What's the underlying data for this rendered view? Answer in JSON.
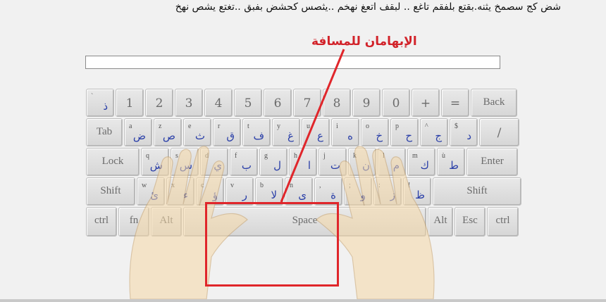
{
  "practice_text": "شض كج سصمخ يثنه.بقتع بلفقم تاغع .. لبقف اتعغ نهخم ..يثصس كحشض بفبق ..تغتع يشص نهخ",
  "callout": "الإبهامان للمسافة",
  "input": {
    "value": ""
  },
  "keyboard": {
    "row1": [
      {
        "lat": "`",
        "ar": "ذ"
      },
      {
        "main": "1"
      },
      {
        "main": "2"
      },
      {
        "main": "3"
      },
      {
        "main": "4"
      },
      {
        "main": "5"
      },
      {
        "main": "6"
      },
      {
        "main": "7"
      },
      {
        "main": "8"
      },
      {
        "main": "9"
      },
      {
        "main": "0"
      },
      {
        "main": "+"
      },
      {
        "main": "="
      },
      {
        "label": "Back"
      }
    ],
    "row2": [
      {
        "label": "Tab"
      },
      {
        "lat": "a",
        "ar": "ض"
      },
      {
        "lat": "z",
        "ar": "ص"
      },
      {
        "lat": "e",
        "ar": "ث"
      },
      {
        "lat": "r",
        "ar": "ق"
      },
      {
        "lat": "t",
        "ar": "ف"
      },
      {
        "lat": "y",
        "ar": "غ"
      },
      {
        "lat": "u",
        "ar": "ع"
      },
      {
        "lat": "i",
        "ar": "ه"
      },
      {
        "lat": "o",
        "ar": "خ"
      },
      {
        "lat": "p",
        "ar": "ح"
      },
      {
        "lat": "^",
        "ar": "ج"
      },
      {
        "lat": "$",
        "ar": "د"
      },
      {
        "main": "/"
      }
    ],
    "row3": [
      {
        "label": "Lock"
      },
      {
        "lat": "q",
        "ar": "ش"
      },
      {
        "lat": "s",
        "ar": "س"
      },
      {
        "lat": "d",
        "ar": "ي"
      },
      {
        "lat": "f",
        "ar": "ب"
      },
      {
        "lat": "g",
        "ar": "ل"
      },
      {
        "lat": "h",
        "ar": "ا"
      },
      {
        "lat": "j",
        "ar": "ت"
      },
      {
        "lat": "k",
        "ar": "ن"
      },
      {
        "lat": "l",
        "ar": "م"
      },
      {
        "lat": "m",
        "ar": "ك"
      },
      {
        "lat": "ù",
        "ar": "ط"
      },
      {
        "label": "Enter"
      }
    ],
    "row4": [
      {
        "label": "Shift"
      },
      {
        "lat": "w",
        "ar": "ئ"
      },
      {
        "lat": "x",
        "ar": "ء"
      },
      {
        "lat": "c",
        "ar": "ؤ"
      },
      {
        "lat": "v",
        "ar": "ر"
      },
      {
        "lat": "b",
        "ar": "لا"
      },
      {
        "lat": "n",
        "ar": "ى"
      },
      {
        "lat": ",",
        "ar": "ة"
      },
      {
        "lat": ";",
        "ar": "و"
      },
      {
        "lat": ":",
        "ar": "ز"
      },
      {
        "lat": "!",
        "ar": "ظ"
      },
      {
        "label": "Shift"
      }
    ],
    "row5": [
      {
        "label": "ctrl"
      },
      {
        "label": "fn"
      },
      {
        "label": "Alt"
      },
      {
        "label": "Space"
      },
      {
        "label": "Alt"
      },
      {
        "label": "Esc"
      },
      {
        "label": "ctrl"
      }
    ]
  },
  "colors": {
    "highlight": "#e0262b",
    "arabic_letters": "#2a3fa8",
    "callout": "#d2232a"
  }
}
